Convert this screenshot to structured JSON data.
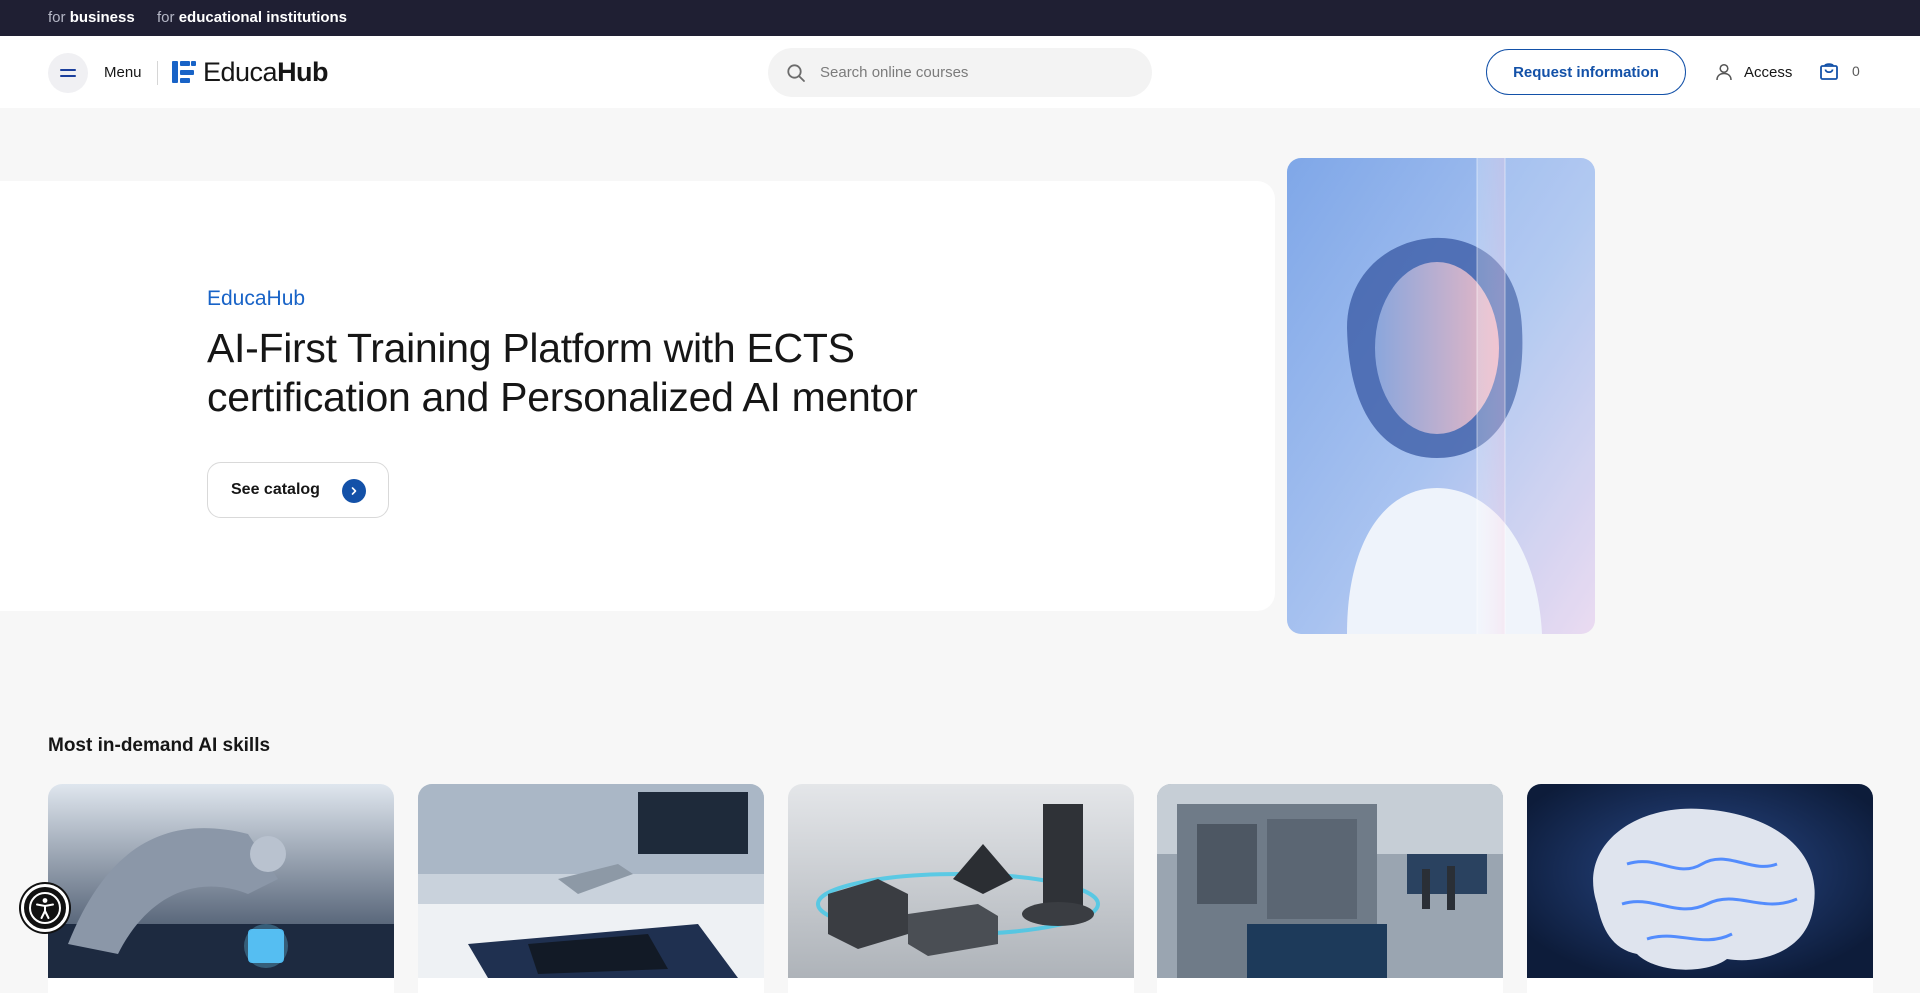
{
  "topbar": {
    "business": {
      "prefix": "for",
      "label": "business"
    },
    "institutions": {
      "prefix": "for",
      "label": "educational institutions"
    }
  },
  "header": {
    "menu_label": "Menu",
    "logo": {
      "light": "Educa",
      "bold": "Hub"
    },
    "search": {
      "placeholder": "Search online courses",
      "icon": "search-icon"
    },
    "request_button": "Request information",
    "access_label": "Access",
    "cart_count": "0"
  },
  "hero": {
    "brand": "EducaHub",
    "title": "AI-First Training Platform with ECTS certification and Personalized AI mentor",
    "cta": "See catalog"
  },
  "skills": {
    "title": "Most in-demand AI skills",
    "cards": [
      {
        "name": "robot-hand-chip"
      },
      {
        "name": "robotic-lab-tablet"
      },
      {
        "name": "connected-blocks"
      },
      {
        "name": "industrial-automation"
      },
      {
        "name": "glowing-brain"
      }
    ]
  },
  "colors": {
    "topbar": "#1f1f33",
    "accent": "#1351a8",
    "brand_blue": "#1863c7",
    "page_bg": "#f7f7f7"
  }
}
